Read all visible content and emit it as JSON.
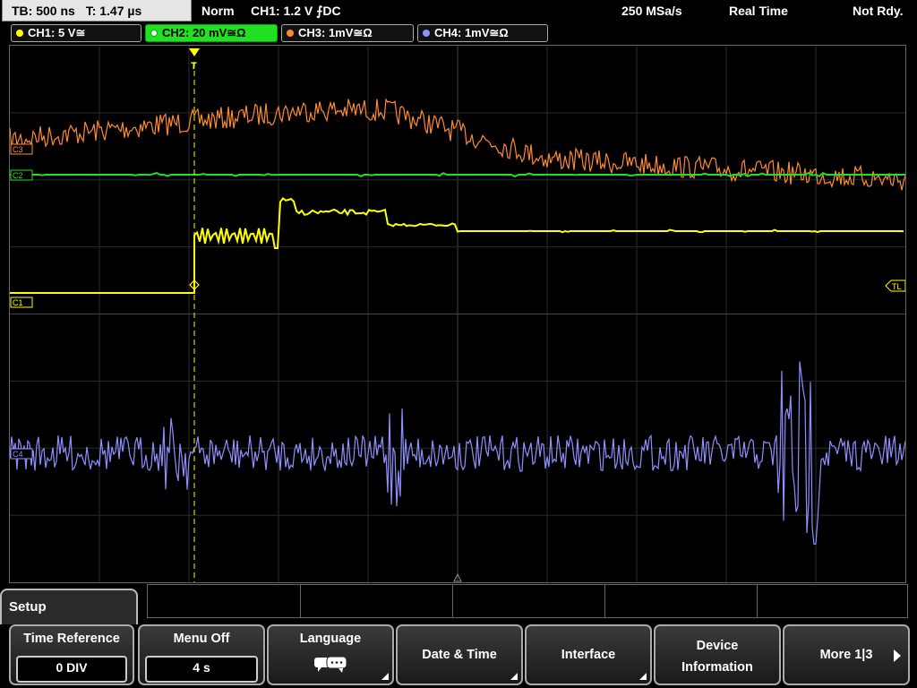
{
  "status": {
    "timebase": "TB: 500 ns",
    "trigger_time": "T: 1.47 µs",
    "mode": "Norm",
    "trigger": "CH1: 1.2 V ⨍DC",
    "sample_rate": "250 MSa/s",
    "acq_mode": "Real Time",
    "ready_state": "Not Rdy."
  },
  "channels": [
    {
      "label": "CH1: 5 V≅",
      "color": "#ffff00",
      "active": false
    },
    {
      "label": "CH2: 20 mV≅Ω",
      "color": "#22e022",
      "active": true
    },
    {
      "label": "CH3: 1mV≅Ω",
      "color": "#ff8a33",
      "active": false
    },
    {
      "label": "CH4: 1mV≅Ω",
      "color": "#8f8fff",
      "active": false
    }
  ],
  "markers": {
    "c1": "C1",
    "c2": "C2",
    "c3": "C3",
    "c4": "C4",
    "trigger_level": "TL",
    "trigger_pos": "T"
  },
  "menu": {
    "title": "Setup",
    "softkeys": [
      {
        "label": "Time Reference",
        "value": "0 DIV"
      },
      {
        "label": "Menu Off",
        "value": "4 s"
      },
      {
        "label": "Language",
        "icon": "speech-bubbles-icon"
      },
      {
        "label": "Date & Time"
      },
      {
        "label": "Interface"
      },
      {
        "label_line1": "Device",
        "label_line2": "Information"
      },
      {
        "label": "More 1|3"
      }
    ]
  }
}
